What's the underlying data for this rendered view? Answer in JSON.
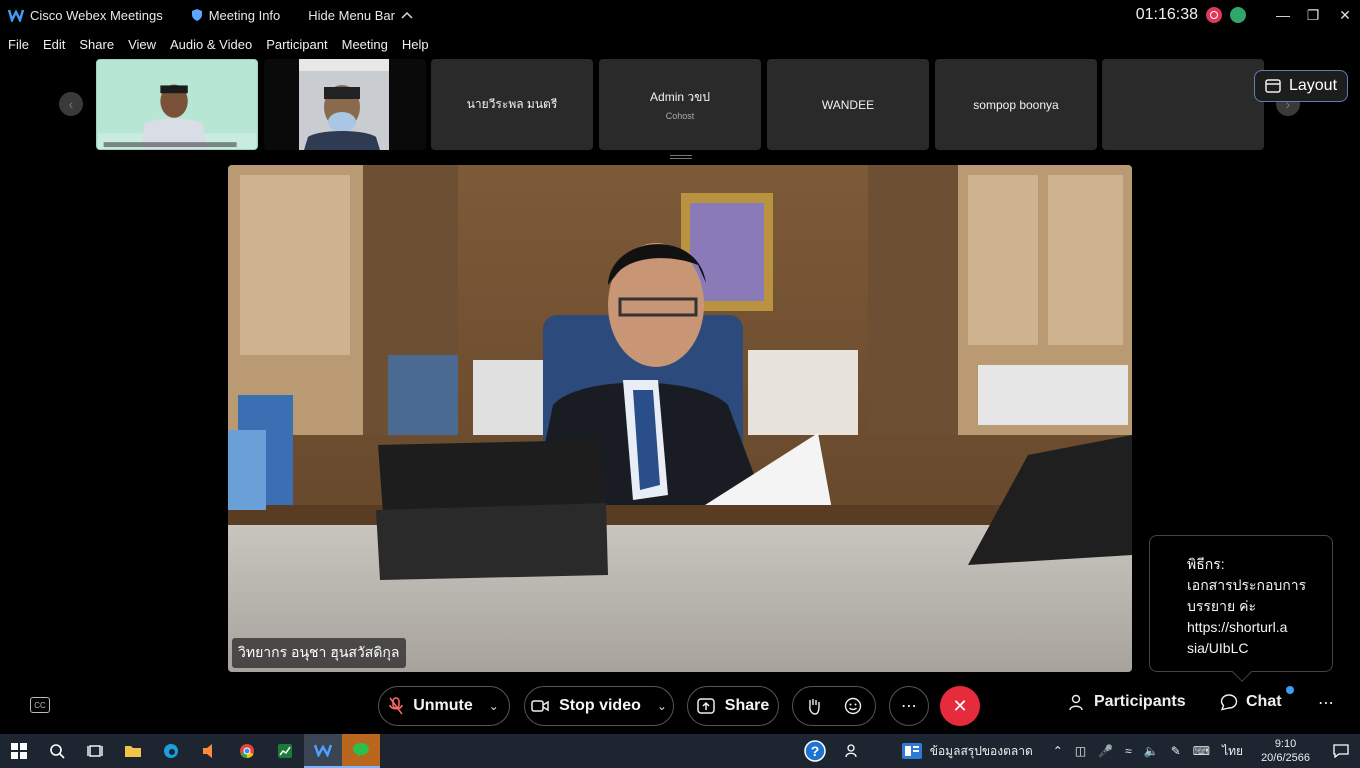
{
  "titlebar": {
    "app_name": "Cisco Webex Meetings",
    "meeting_info": "Meeting Info",
    "hide_menu": "Hide Menu Bar",
    "clock": "01:16:38"
  },
  "menu": [
    "File",
    "Edit",
    "Share",
    "View",
    "Audio & Video",
    "Participant",
    "Meeting",
    "Help"
  ],
  "filmstrip": {
    "tiles": [
      {
        "name": "",
        "sub": ""
      },
      {
        "name": "",
        "sub": ""
      },
      {
        "name": "นายวีระพล มนตรี",
        "sub": ""
      },
      {
        "name": "Admin วขป",
        "sub": "Cohost"
      },
      {
        "name": "WANDEE",
        "sub": ""
      },
      {
        "name": "sompop boonya",
        "sub": ""
      },
      {
        "name": "",
        "sub": ""
      }
    ],
    "layout_label": "Layout"
  },
  "main_video": {
    "speaker_name": "วิทยากร อนุชา ฮุนสวัสดิกุล"
  },
  "chat_popup": {
    "sender": "พิธีกร:",
    "line1": "เอกสารประกอบการ",
    "line2": "บรรยาย ค่ะ",
    "line3": "https://shorturl.a",
    "line4": "sia/UIbLC"
  },
  "controls": {
    "unmute": "Unmute",
    "stop_video": "Stop video",
    "share": "Share",
    "participants": "Participants",
    "chat": "Chat"
  },
  "colors": {
    "end_call": "#e62b3c",
    "accent": "#3f9bf5",
    "layout_border": "#5d7fb5"
  },
  "taskbar": {
    "news": "ข้อมูลสรุปของตลาด",
    "lang": "ไทย",
    "time": "9:10",
    "date": "20/6/2566"
  }
}
